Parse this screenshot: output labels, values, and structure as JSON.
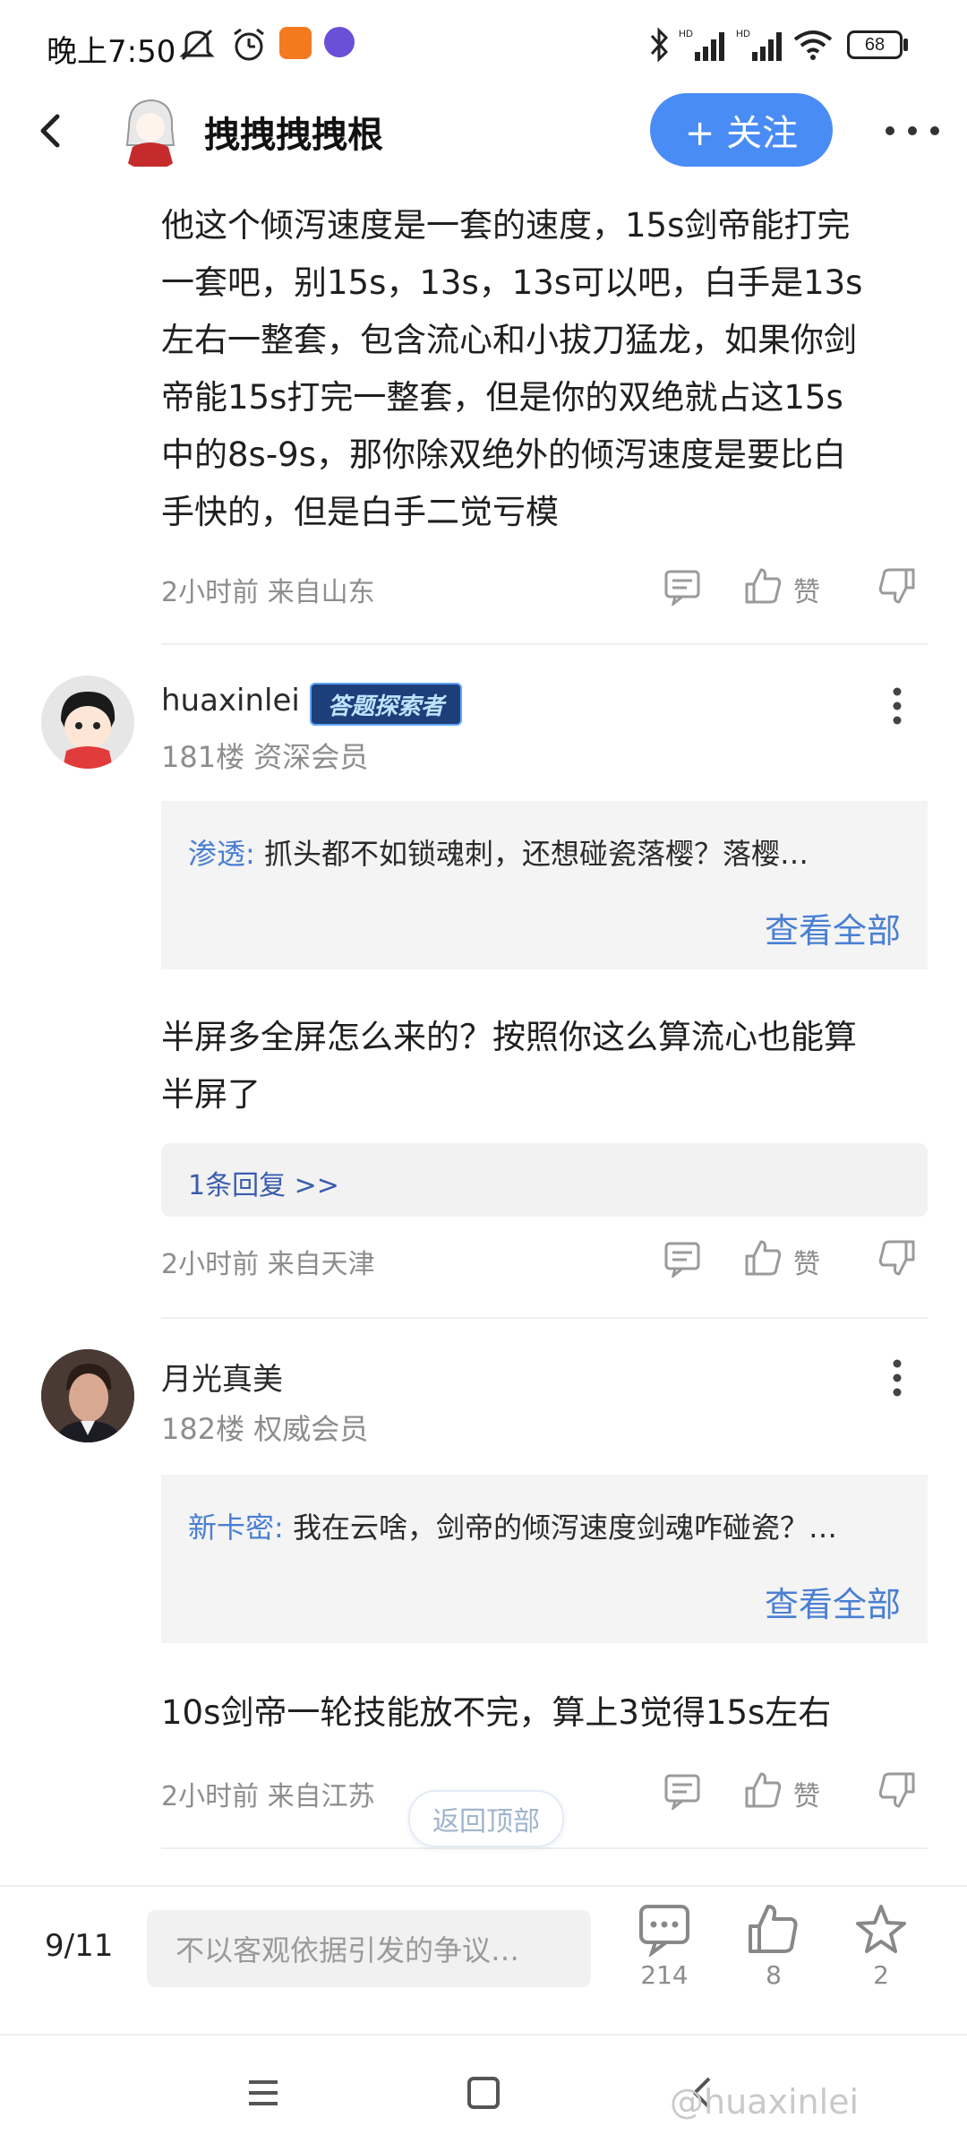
{
  "status_bar": {
    "time": "晚上7:50",
    "battery": "68",
    "network_label": "HD"
  },
  "header": {
    "author": "拽拽拽拽根",
    "follow_label": "+ 关注"
  },
  "post1": {
    "lines": [
      "他这个倾泻速度是一套的速度，15s剑帝能打完",
      "一套吧，别15s，13s，13s可以吧，白手是13s",
      "左右一整套，包含流心和小拔刀猛龙，如果你剑",
      "帝能15s打完一整套，但是你的双绝就占这15s",
      "中的8s-9s，那你除双绝外的倾泻速度是要比白",
      "手快的，但是白手二觉亏模"
    ],
    "meta": "2小时前 来自山东",
    "like_label": "赞"
  },
  "post2": {
    "user": "huaxinlei",
    "badge": "答题探索者",
    "floor": "181楼 资深会员",
    "quote_user": "渗透:",
    "quote_text": "抓头都不如锁魂刺，还想碰瓷落樱？落樱…",
    "view_all": "查看全部",
    "lines": [
      "半屏多全屏怎么来的？按照你这么算流心也能算",
      "半屏了"
    ],
    "reply": "1条回复 >>",
    "meta": "2小时前 来自天津",
    "like_label": "赞"
  },
  "post3": {
    "user": "月光真美",
    "floor": "182楼 权威会员",
    "quote_user": "新卡密:",
    "quote_text": "我在云啥，剑帝的倾泻速度剑魂咋碰瓷？…",
    "view_all": "查看全部",
    "lines": [
      "10s剑帝一轮技能放不完，算上3觉得15s左右"
    ],
    "meta": "2小时前 来自江苏",
    "like_label": "赞"
  },
  "back_to_top": "返回顶部",
  "bottom_bar": {
    "page": "9/11",
    "input_placeholder": "不以客观依据引发的争议…",
    "comments": "214",
    "likes": "8",
    "favorites": "2"
  },
  "watermark": "@huaxinlei",
  "colors": {
    "accent": "#4a8cf5",
    "link": "#4a7fd3",
    "muted": "#8d8d8d"
  }
}
